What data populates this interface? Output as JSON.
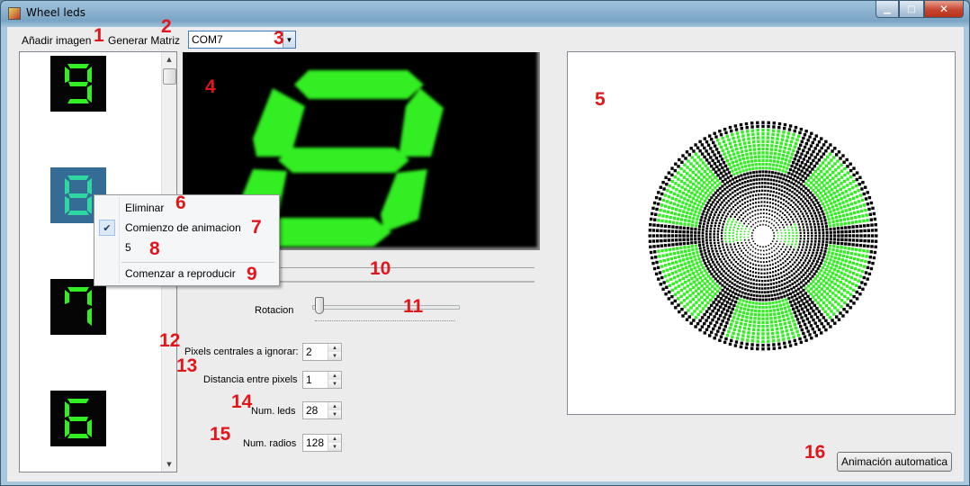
{
  "window": {
    "title": "Wheel leds",
    "controls": {
      "minimize": "▁",
      "maximize": "□",
      "close": "✕"
    }
  },
  "menu": {
    "add_image": "Añadir imagen",
    "generate_matrix": "Generar Matriz"
  },
  "port_combo": {
    "value": "COM7",
    "icon": "chevron-down-icon"
  },
  "image_list": {
    "thumbnails": [
      {
        "digit": "9",
        "selected": false
      },
      {
        "digit": "8",
        "selected": true
      },
      {
        "digit": "7",
        "selected": false
      },
      {
        "digit": "6",
        "selected": false
      }
    ]
  },
  "context_menu": {
    "items": [
      {
        "label": "Eliminar",
        "checked": false
      },
      {
        "label": "Comienzo de animacion",
        "checked": true
      },
      {
        "label": "5",
        "checked": false
      },
      {
        "label": "Comenzar a reproducir",
        "checked": false
      }
    ]
  },
  "preview": {
    "digit": "8",
    "segment_color": "#33ee22"
  },
  "rotation": {
    "label": "Rotacion",
    "value": 0.05
  },
  "settings": {
    "ignore_center": {
      "label": "Pixels centrales a ignorar:",
      "value": "2"
    },
    "pixel_distance": {
      "label": "Distancia entre pixels",
      "value": "1"
    },
    "num_leds": {
      "label": "Num. leds",
      "value": "28"
    },
    "num_radios": {
      "label": "Num. radios",
      "value": "128"
    }
  },
  "auto_button": {
    "label": "Animación automatica"
  },
  "annotations": [
    "1",
    "2",
    "3",
    "4",
    "5",
    "6",
    "7",
    "8",
    "9",
    "10",
    "11",
    "12",
    "13",
    "14",
    "15",
    "16"
  ],
  "colors": {
    "lit": "#33ee22",
    "dot": "#000000",
    "annotation": "#e0161b"
  }
}
